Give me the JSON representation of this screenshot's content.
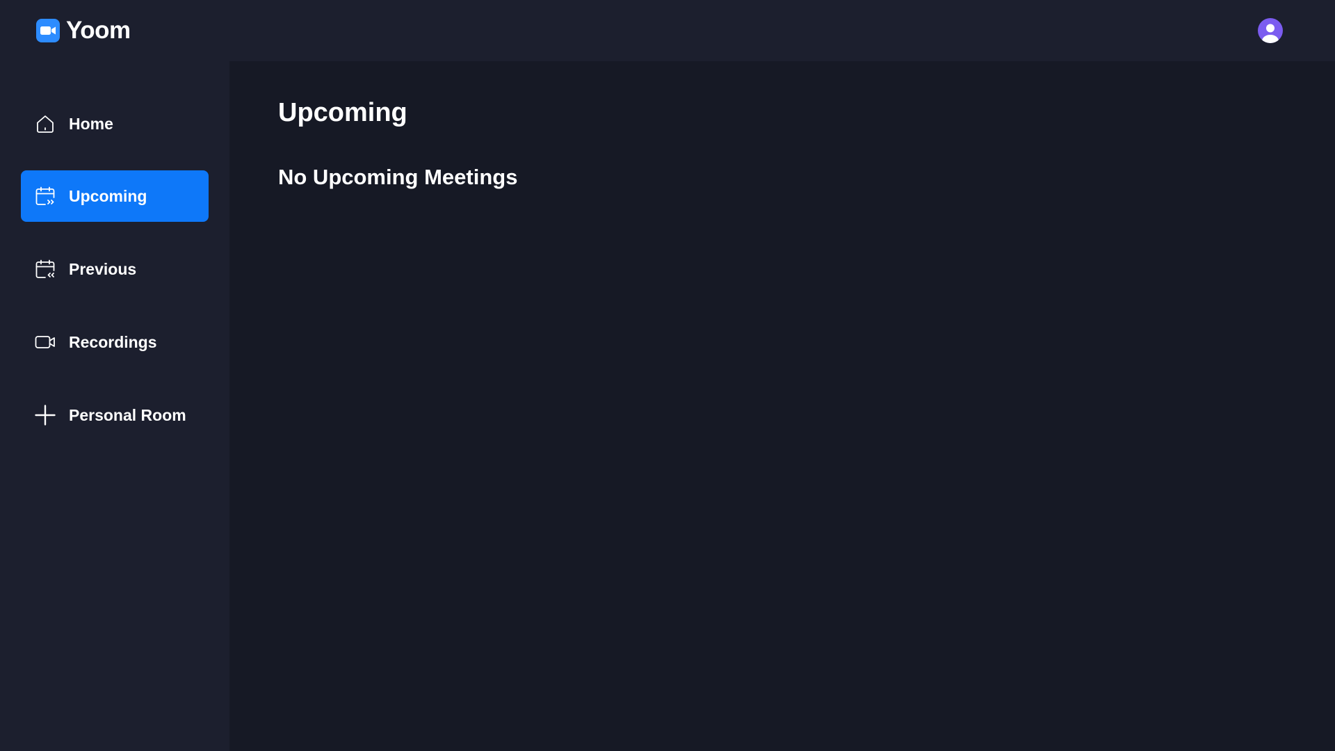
{
  "app": {
    "name": "Yoom",
    "logo_icon": "video-camera-logo-icon",
    "accent_color": "#0E78F9"
  },
  "header": {
    "avatar_icon": "user-avatar-icon",
    "avatar_color": "#7B5CF0"
  },
  "sidebar": {
    "items": [
      {
        "label": "Home",
        "icon": "home-icon",
        "active": false
      },
      {
        "label": "Upcoming",
        "icon": "calendar-upcoming-icon",
        "active": true
      },
      {
        "label": "Previous",
        "icon": "calendar-previous-icon",
        "active": false
      },
      {
        "label": "Recordings",
        "icon": "video-icon",
        "active": false
      },
      {
        "label": "Personal Room",
        "icon": "plus-icon",
        "active": false
      }
    ]
  },
  "main": {
    "title": "Upcoming",
    "empty_message": "No Upcoming Meetings"
  }
}
